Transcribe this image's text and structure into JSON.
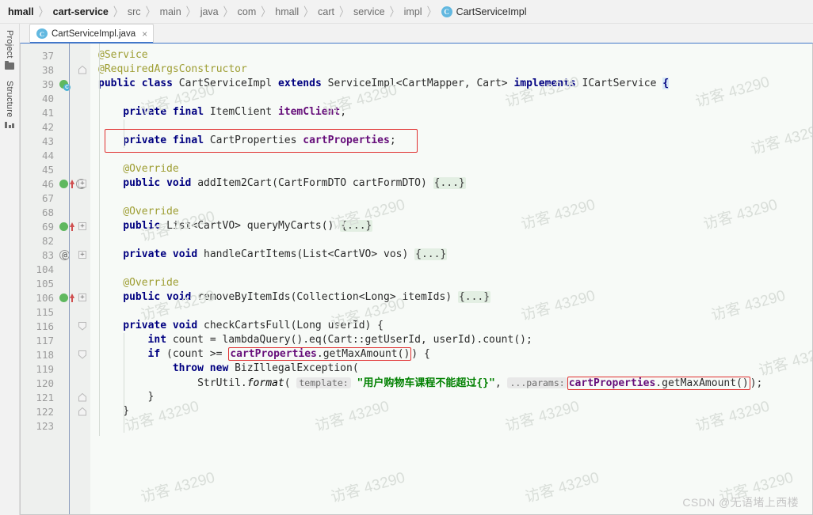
{
  "breadcrumb": {
    "items": [
      {
        "label": "hmall",
        "style": "bold"
      },
      {
        "label": "cart-service",
        "style": "bold"
      },
      {
        "label": "src",
        "style": "normal"
      },
      {
        "label": "main",
        "style": "normal"
      },
      {
        "label": "java",
        "style": "normal"
      },
      {
        "label": "com",
        "style": "normal"
      },
      {
        "label": "hmall",
        "style": "normal"
      },
      {
        "label": "cart",
        "style": "normal"
      },
      {
        "label": "service",
        "style": "normal"
      },
      {
        "label": "impl",
        "style": "normal"
      }
    ],
    "separator": "〉",
    "current": {
      "icon": "class-icon",
      "icon_letter": "C",
      "label": "CartServiceImpl"
    }
  },
  "tool_strip": {
    "items": [
      {
        "label": "Project",
        "icon": "folder-icon"
      },
      {
        "label": "Structure",
        "icon": "structure-icon"
      }
    ]
  },
  "tab": {
    "icon_letter": "C",
    "label": "CartServiceImpl.java",
    "close_glyph": "×"
  },
  "editor": {
    "language": "java",
    "line_numbers": [
      "37",
      "38",
      "39",
      "40",
      "41",
      "42",
      "43",
      "44",
      "45",
      "46",
      "67",
      "68",
      "69",
      "82",
      "83",
      "104",
      "105",
      "106",
      "115",
      "116",
      "117",
      "118",
      "119",
      "120",
      "121",
      "122",
      "123"
    ],
    "gutter_markers": {
      "39": [
        "bean-marker",
        "class-badge"
      ],
      "46": [
        "bean-marker",
        "override-arrow",
        "at-marker",
        "fold-plus"
      ],
      "69": [
        "bean-marker",
        "override-arrow",
        "fold-plus"
      ],
      "83": [
        "at-marker",
        "fold-plus"
      ],
      "106": [
        "bean-marker",
        "override-arrow",
        "fold-plus"
      ],
      "116": [
        "fold-minus"
      ],
      "118": [
        "fold-minus"
      ],
      "121": [
        "fold-end"
      ],
      "122": [
        "fold-end"
      ],
      "38": [
        "fold-end"
      ]
    },
    "lines": [
      {
        "n": "37",
        "indent": 0,
        "clipped": true,
        "tokens": [
          {
            "t": "@Service",
            "c": "ann"
          }
        ]
      },
      {
        "n": "38",
        "indent": 0,
        "tokens": [
          {
            "t": "@RequiredArgsConstructor",
            "c": "ann"
          }
        ]
      },
      {
        "n": "39",
        "indent": 0,
        "tokens": [
          {
            "t": "public ",
            "c": "kw"
          },
          {
            "t": "class ",
            "c": "kw"
          },
          {
            "t": "CartServiceImpl ",
            "c": "plain"
          },
          {
            "t": "extends ",
            "c": "kw"
          },
          {
            "t": "ServiceImpl<CartMapper, Cart> ",
            "c": "plain"
          },
          {
            "t": "implements ",
            "c": "kw"
          },
          {
            "t": "ICartService ",
            "c": "plain"
          },
          {
            "t": "{",
            "c": "brace-hl"
          }
        ]
      },
      {
        "n": "40",
        "indent": 0,
        "tokens": []
      },
      {
        "n": "41",
        "indent": 1,
        "tokens": [
          {
            "t": "private ",
            "c": "kw"
          },
          {
            "t": "final ",
            "c": "kw"
          },
          {
            "t": "ItemClient ",
            "c": "plain"
          },
          {
            "t": "itemClient",
            "c": "fld"
          },
          {
            "t": ";",
            "c": "plain"
          }
        ]
      },
      {
        "n": "42",
        "indent": 0,
        "tokens": []
      },
      {
        "n": "43",
        "indent": 1,
        "highlight": "red-box-1",
        "tokens": [
          {
            "t": "private ",
            "c": "kw"
          },
          {
            "t": "final ",
            "c": "kw"
          },
          {
            "t": "CartProperties ",
            "c": "plain"
          },
          {
            "t": "cartProperties",
            "c": "fld"
          },
          {
            "t": ";",
            "c": "plain"
          }
        ]
      },
      {
        "n": "44",
        "indent": 0,
        "tokens": []
      },
      {
        "n": "45",
        "indent": 1,
        "tokens": [
          {
            "t": "@Override",
            "c": "ann"
          }
        ]
      },
      {
        "n": "46",
        "indent": 1,
        "tokens": [
          {
            "t": "public ",
            "c": "kw"
          },
          {
            "t": "void ",
            "c": "kw"
          },
          {
            "t": "addItem2Cart(CartFormDTO cartFormDTO) ",
            "c": "plain"
          },
          {
            "t": "{...}",
            "c": "fold-tag"
          }
        ]
      },
      {
        "n": "67",
        "indent": 0,
        "tokens": []
      },
      {
        "n": "68",
        "indent": 1,
        "tokens": [
          {
            "t": "@Override",
            "c": "ann"
          }
        ]
      },
      {
        "n": "69",
        "indent": 1,
        "tokens": [
          {
            "t": "public ",
            "c": "kw"
          },
          {
            "t": "List<CartVO> queryMyCarts() ",
            "c": "plain"
          },
          {
            "t": "{...}",
            "c": "fold-tag"
          }
        ]
      },
      {
        "n": "82",
        "indent": 0,
        "tokens": []
      },
      {
        "n": "83",
        "indent": 1,
        "tokens": [
          {
            "t": "private ",
            "c": "kw"
          },
          {
            "t": "void ",
            "c": "kw"
          },
          {
            "t": "handleCartItems(List<CartVO> vos) ",
            "c": "plain"
          },
          {
            "t": "{...}",
            "c": "fold-tag"
          }
        ]
      },
      {
        "n": "104",
        "indent": 0,
        "tokens": []
      },
      {
        "n": "105",
        "indent": 1,
        "tokens": [
          {
            "t": "@Override",
            "c": "ann"
          }
        ]
      },
      {
        "n": "106",
        "indent": 1,
        "tokens": [
          {
            "t": "public ",
            "c": "kw"
          },
          {
            "t": "void ",
            "c": "kw"
          },
          {
            "t": "removeByItemIds(Collection<Long> itemIds) ",
            "c": "plain"
          },
          {
            "t": "{...}",
            "c": "fold-tag"
          }
        ]
      },
      {
        "n": "115",
        "indent": 0,
        "tokens": []
      },
      {
        "n": "116",
        "indent": 1,
        "tokens": [
          {
            "t": "private ",
            "c": "kw"
          },
          {
            "t": "void ",
            "c": "kw"
          },
          {
            "t": "checkCartsFull(Long userId) {",
            "c": "plain"
          }
        ]
      },
      {
        "n": "117",
        "indent": 2,
        "tokens": [
          {
            "t": "int ",
            "c": "kw"
          },
          {
            "t": "count = lambdaQuery().eq(Cart::getUserId, userId).count();",
            "c": "plain"
          }
        ]
      },
      {
        "n": "118",
        "indent": 2,
        "tokens": [
          {
            "t": "if ",
            "c": "kw"
          },
          {
            "t": "(count >= ",
            "c": "plain"
          },
          {
            "t": "cartProperties",
            "c": "fld",
            "box": "start"
          },
          {
            "t": ".getMaxAmount()",
            "c": "plain",
            "box": "end"
          },
          {
            "t": ") {",
            "c": "plain"
          }
        ]
      },
      {
        "n": "119",
        "indent": 3,
        "tokens": [
          {
            "t": "throw ",
            "c": "kw"
          },
          {
            "t": "new ",
            "c": "kw"
          },
          {
            "t": "BizIllegalException(",
            "c": "plain"
          }
        ]
      },
      {
        "n": "120",
        "indent": 4,
        "tokens": [
          {
            "t": "StrUtil.",
            "c": "plain"
          },
          {
            "t": "format",
            "c": "ital"
          },
          {
            "t": "( ",
            "c": "plain"
          },
          {
            "t": "template:",
            "c": "hint"
          },
          {
            "t": " ",
            "c": "plain"
          },
          {
            "t": "\"用户购物车课程不能超过{}\"",
            "c": "str"
          },
          {
            "t": ", ",
            "c": "plain"
          },
          {
            "t": "...params:",
            "c": "hint"
          },
          {
            "t": "cartProperties",
            "c": "fld",
            "box": "start"
          },
          {
            "t": ".getMaxAmount()",
            "c": "plain",
            "box": "end"
          },
          {
            "t": ");",
            "c": "plain"
          }
        ]
      },
      {
        "n": "121",
        "indent": 2,
        "tokens": [
          {
            "t": "}",
            "c": "plain"
          }
        ]
      },
      {
        "n": "122",
        "indent": 1,
        "tokens": [
          {
            "t": "}",
            "c": "plain"
          }
        ]
      },
      {
        "n": "123",
        "indent": 0,
        "clipped": true,
        "tokens": []
      }
    ],
    "red_annotations": [
      {
        "name": "cart-properties-field-box",
        "line": "43"
      },
      {
        "name": "get-max-amount-call-box-1",
        "line": "118"
      },
      {
        "name": "get-max-amount-call-box-2",
        "line": "120"
      }
    ]
  },
  "watermarks": {
    "tile_text": "访客 43290",
    "footer_text": "CSDN @无语堵上西楼"
  },
  "colors": {
    "keyword": "#000080",
    "annotation": "#9e9e33",
    "field": "#660e7a",
    "string": "#008000",
    "accent": "#4277c9",
    "red_highlight": "#e03030",
    "editor_bg": "#f7faf7",
    "gutter_bg": "#eef0ee"
  }
}
